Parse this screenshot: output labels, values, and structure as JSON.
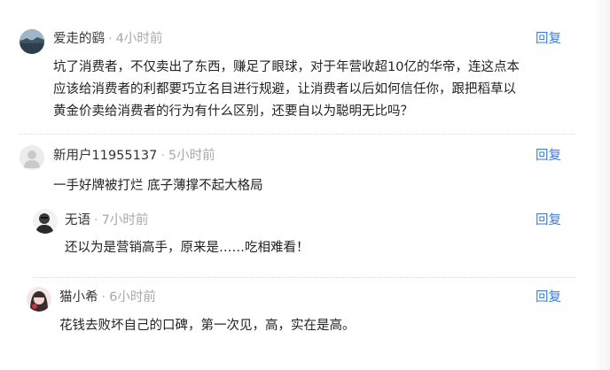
{
  "comments": [
    {
      "name": "爱走的鹞",
      "time": "4小时前",
      "reply": "回复",
      "avatar": "landscape-avatar-icon",
      "lines": [
        "坑了消费者，不仅卖出了东西，赚足了眼球，对于年营收超10亿的华帝，连这点本",
        "应该给消费者的利都要巧立名目进行规避，让消费者以后如何信任你，跟把稻草以",
        "黄金价卖给消费者的行为有什么区别，还要自以为聪明无比吗？"
      ]
    },
    {
      "name": "新用户11955137",
      "time": "5小时前",
      "reply": "回复",
      "avatar": "default-user-avatar-icon",
      "lines": [
        "一手好牌被打烂 底子薄撑不起大格局"
      ]
    },
    {
      "name": "无语",
      "time": "7小时前",
      "reply": "回复",
      "avatar": "person-photo-avatar-icon",
      "lines": [
        "还以为是营销高手，原来是……吃相难看！"
      ]
    },
    {
      "name": "猫小希",
      "time": "6小时前",
      "reply": "回复",
      "avatar": "girl-illustration-avatar-icon",
      "lines": [
        "花钱去败坏自己的口碑，第一次见，高，实在是高。"
      ]
    }
  ],
  "separator": "·"
}
